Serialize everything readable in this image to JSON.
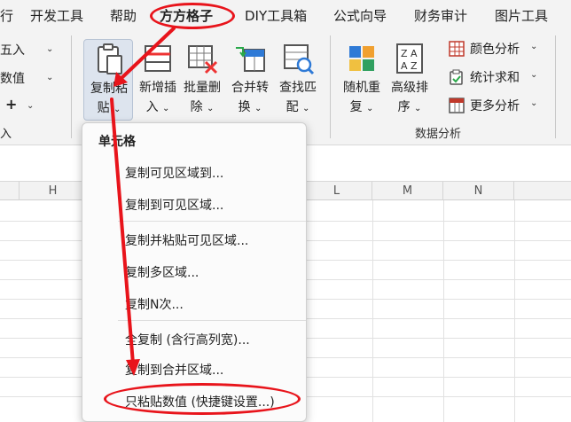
{
  "ribbon": {
    "tabs": [
      "行",
      "开发工具",
      "帮助",
      "方方格子",
      "DIY工具箱",
      "公式向导",
      "财务审计",
      "图片工具"
    ],
    "left_items": [
      "五入",
      "数值",
      "+"
    ],
    "left_cut_label": "入",
    "big_buttons": [
      {
        "line1": "复制粘",
        "line2": "贴"
      },
      {
        "line1": "新增插",
        "line2": "入"
      },
      {
        "line1": "批量删",
        "line2": "除"
      },
      {
        "line1": "合并转",
        "line2": "换"
      },
      {
        "line1": "查找匹",
        "line2": "配"
      },
      {
        "line1": "随机重",
        "line2": "复"
      },
      {
        "line1": "高级排",
        "line2": "序"
      }
    ],
    "analysis_items": [
      "颜色分析",
      "统计求和",
      "更多分析"
    ],
    "group_label": "数据分析"
  },
  "sheet": {
    "columns": [
      "H",
      "L",
      "M",
      "N"
    ]
  },
  "menu": {
    "title": "单元格",
    "items": [
      "复制可见区域到...",
      "复制到可见区域...",
      "复制并粘贴可见区域...",
      "复制多区域...",
      "复制N次...",
      "全复制 (含行高列宽)...",
      "复制到合并区域...",
      "只粘贴数值 (快捷键设置...)"
    ]
  },
  "colors": {
    "annotation": "#e8141b",
    "ribbon_bg": "#f3f3f3",
    "selected_button": "#dde4ee"
  }
}
